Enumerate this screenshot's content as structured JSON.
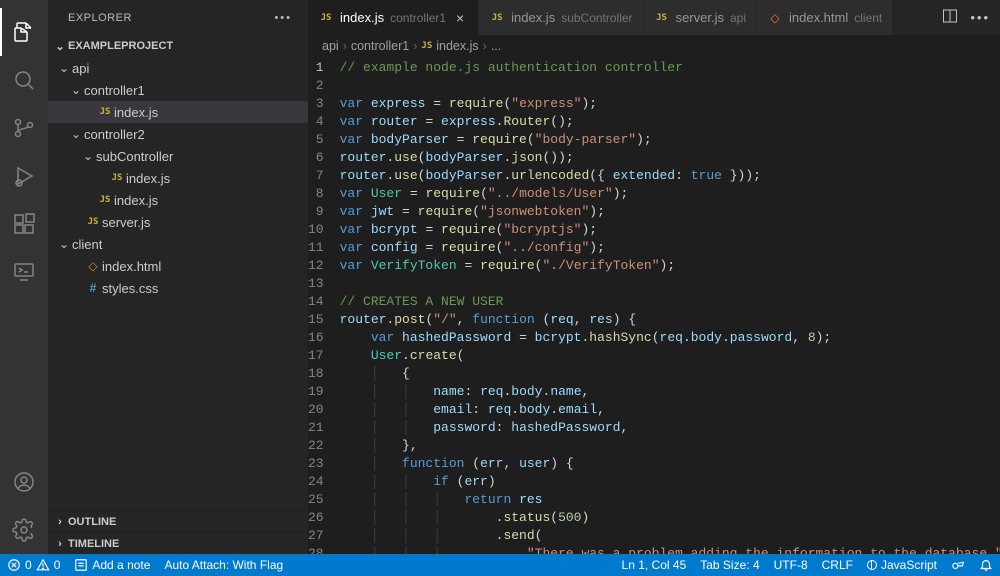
{
  "sidebar": {
    "title": "EXPLORER",
    "project": "EXAMPLEPROJECT",
    "tree": [
      {
        "kind": "folder",
        "open": true,
        "depth": 0,
        "label": "api"
      },
      {
        "kind": "folder",
        "open": true,
        "depth": 1,
        "label": "controller1"
      },
      {
        "kind": "file",
        "icon": "js",
        "depth": 2,
        "label": "index.js",
        "selected": true
      },
      {
        "kind": "folder",
        "open": true,
        "depth": 1,
        "label": "controller2"
      },
      {
        "kind": "folder",
        "open": true,
        "depth": 2,
        "label": "subController"
      },
      {
        "kind": "file",
        "icon": "js",
        "depth": 3,
        "label": "index.js"
      },
      {
        "kind": "file",
        "icon": "js",
        "depth": 2,
        "label": "index.js"
      },
      {
        "kind": "file",
        "icon": "js",
        "depth": 1,
        "label": "server.js"
      },
      {
        "kind": "folder",
        "open": true,
        "depth": 0,
        "label": "client"
      },
      {
        "kind": "file",
        "icon": "html",
        "depth": 1,
        "label": "index.html"
      },
      {
        "kind": "file",
        "icon": "css",
        "depth": 1,
        "label": "styles.css"
      }
    ],
    "sections": {
      "outline": "OUTLINE",
      "timeline": "TIMELINE"
    }
  },
  "tabs": [
    {
      "icon": "js",
      "label": "index.js",
      "desc": "controller1",
      "active": true,
      "close": true
    },
    {
      "icon": "js",
      "label": "index.js",
      "desc": "subController",
      "active": false,
      "close": false
    },
    {
      "icon": "js",
      "label": "server.js",
      "desc": "api",
      "active": false,
      "close": false
    },
    {
      "icon": "html",
      "label": "index.html",
      "desc": "client",
      "active": false,
      "close": false
    }
  ],
  "breadcrumbs": {
    "parts": [
      "api",
      "controller1"
    ],
    "file_icon": "js",
    "file": "index.js",
    "trail": "..."
  },
  "code": {
    "first_line": 1,
    "lines": [
      [
        [
          "comment",
          "// example node.js authentication controller"
        ]
      ],
      [],
      [
        [
          "keyword",
          "var"
        ],
        [
          "punc",
          " "
        ],
        [
          "var",
          "express"
        ],
        [
          "punc",
          " = "
        ],
        [
          "func",
          "require"
        ],
        [
          "punc",
          "("
        ],
        [
          "string",
          "\"express\""
        ],
        [
          "punc",
          ");"
        ]
      ],
      [
        [
          "keyword",
          "var"
        ],
        [
          "punc",
          " "
        ],
        [
          "var",
          "router"
        ],
        [
          "punc",
          " = "
        ],
        [
          "var",
          "express"
        ],
        [
          "punc",
          "."
        ],
        [
          "func",
          "Router"
        ],
        [
          "punc",
          "();"
        ]
      ],
      [
        [
          "keyword",
          "var"
        ],
        [
          "punc",
          " "
        ],
        [
          "var",
          "bodyParser"
        ],
        [
          "punc",
          " = "
        ],
        [
          "func",
          "require"
        ],
        [
          "punc",
          "("
        ],
        [
          "string",
          "\"body-parser\""
        ],
        [
          "punc",
          ");"
        ]
      ],
      [
        [
          "var",
          "router"
        ],
        [
          "punc",
          "."
        ],
        [
          "func",
          "use"
        ],
        [
          "punc",
          "("
        ],
        [
          "var",
          "bodyParser"
        ],
        [
          "punc",
          "."
        ],
        [
          "func",
          "json"
        ],
        [
          "punc",
          "());"
        ]
      ],
      [
        [
          "var",
          "router"
        ],
        [
          "punc",
          "."
        ],
        [
          "func",
          "use"
        ],
        [
          "punc",
          "("
        ],
        [
          "var",
          "bodyParser"
        ],
        [
          "punc",
          "."
        ],
        [
          "func",
          "urlencoded"
        ],
        [
          "punc",
          "({ "
        ],
        [
          "var",
          "extended"
        ],
        [
          "punc",
          ": "
        ],
        [
          "const",
          "true"
        ],
        [
          "punc",
          " }));"
        ]
      ],
      [
        [
          "keyword",
          "var"
        ],
        [
          "punc",
          " "
        ],
        [
          "type",
          "User"
        ],
        [
          "punc",
          " = "
        ],
        [
          "func",
          "require"
        ],
        [
          "punc",
          "("
        ],
        [
          "string",
          "\"../models/User\""
        ],
        [
          "punc",
          ");"
        ]
      ],
      [
        [
          "keyword",
          "var"
        ],
        [
          "punc",
          " "
        ],
        [
          "var",
          "jwt"
        ],
        [
          "punc",
          " = "
        ],
        [
          "func",
          "require"
        ],
        [
          "punc",
          "("
        ],
        [
          "string",
          "\"jsonwebtoken\""
        ],
        [
          "punc",
          ");"
        ]
      ],
      [
        [
          "keyword",
          "var"
        ],
        [
          "punc",
          " "
        ],
        [
          "var",
          "bcrypt"
        ],
        [
          "punc",
          " = "
        ],
        [
          "func",
          "require"
        ],
        [
          "punc",
          "("
        ],
        [
          "string",
          "\"bcryptjs\""
        ],
        [
          "punc",
          ");"
        ]
      ],
      [
        [
          "keyword",
          "var"
        ],
        [
          "punc",
          " "
        ],
        [
          "var",
          "config"
        ],
        [
          "punc",
          " = "
        ],
        [
          "func",
          "require"
        ],
        [
          "punc",
          "("
        ],
        [
          "string",
          "\"../config\""
        ],
        [
          "punc",
          ");"
        ]
      ],
      [
        [
          "keyword",
          "var"
        ],
        [
          "punc",
          " "
        ],
        [
          "type",
          "VerifyToken"
        ],
        [
          "punc",
          " = "
        ],
        [
          "func",
          "require"
        ],
        [
          "punc",
          "("
        ],
        [
          "string",
          "\"./VerifyToken\""
        ],
        [
          "punc",
          ");"
        ]
      ],
      [],
      [
        [
          "comment",
          "// CREATES A NEW USER"
        ]
      ],
      [
        [
          "var",
          "router"
        ],
        [
          "punc",
          "."
        ],
        [
          "func",
          "post"
        ],
        [
          "punc",
          "("
        ],
        [
          "string",
          "\"/\""
        ],
        [
          "punc",
          ", "
        ],
        [
          "keyword",
          "function"
        ],
        [
          "punc",
          " ("
        ],
        [
          "var",
          "req"
        ],
        [
          "punc",
          ", "
        ],
        [
          "var",
          "res"
        ],
        [
          "punc",
          ") {"
        ]
      ],
      [
        [
          "punc",
          "    "
        ],
        [
          "keyword",
          "var"
        ],
        [
          "punc",
          " "
        ],
        [
          "var",
          "hashedPassword"
        ],
        [
          "punc",
          " = "
        ],
        [
          "var",
          "bcrypt"
        ],
        [
          "punc",
          "."
        ],
        [
          "func",
          "hashSync"
        ],
        [
          "punc",
          "("
        ],
        [
          "var",
          "req"
        ],
        [
          "punc",
          "."
        ],
        [
          "var",
          "body"
        ],
        [
          "punc",
          "."
        ],
        [
          "var",
          "password"
        ],
        [
          "punc",
          ", "
        ],
        [
          "num",
          "8"
        ],
        [
          "punc",
          ");"
        ]
      ],
      [
        [
          "punc",
          "    "
        ],
        [
          "type",
          "User"
        ],
        [
          "punc",
          "."
        ],
        [
          "func",
          "create"
        ],
        [
          "punc",
          "("
        ]
      ],
      [
        [
          "guide",
          "    │   "
        ],
        [
          "punc",
          "{"
        ]
      ],
      [
        [
          "guide",
          "    │   │   "
        ],
        [
          "var",
          "name"
        ],
        [
          "punc",
          ": "
        ],
        [
          "var",
          "req"
        ],
        [
          "punc",
          "."
        ],
        [
          "var",
          "body"
        ],
        [
          "punc",
          "."
        ],
        [
          "var",
          "name"
        ],
        [
          "punc",
          ","
        ]
      ],
      [
        [
          "guide",
          "    │   │   "
        ],
        [
          "var",
          "email"
        ],
        [
          "punc",
          ": "
        ],
        [
          "var",
          "req"
        ],
        [
          "punc",
          "."
        ],
        [
          "var",
          "body"
        ],
        [
          "punc",
          "."
        ],
        [
          "var",
          "email"
        ],
        [
          "punc",
          ","
        ]
      ],
      [
        [
          "guide",
          "    │   │   "
        ],
        [
          "var",
          "password"
        ],
        [
          "punc",
          ": "
        ],
        [
          "var",
          "hashedPassword"
        ],
        [
          "punc",
          ","
        ]
      ],
      [
        [
          "guide",
          "    │   "
        ],
        [
          "punc",
          "},"
        ]
      ],
      [
        [
          "guide",
          "    │   "
        ],
        [
          "keyword",
          "function"
        ],
        [
          "punc",
          " ("
        ],
        [
          "var",
          "err"
        ],
        [
          "punc",
          ", "
        ],
        [
          "var",
          "user"
        ],
        [
          "punc",
          ") {"
        ]
      ],
      [
        [
          "guide",
          "    │   │   "
        ],
        [
          "keyword",
          "if"
        ],
        [
          "punc",
          " ("
        ],
        [
          "var",
          "err"
        ],
        [
          "punc",
          ")"
        ]
      ],
      [
        [
          "guide",
          "    │   │   │   "
        ],
        [
          "keyword",
          "return"
        ],
        [
          "punc",
          " "
        ],
        [
          "var",
          "res"
        ]
      ],
      [
        [
          "guide",
          "    │   │   │       "
        ],
        [
          "punc",
          "."
        ],
        [
          "func",
          "status"
        ],
        [
          "punc",
          "("
        ],
        [
          "num",
          "500"
        ],
        [
          "punc",
          ")"
        ]
      ],
      [
        [
          "guide",
          "    │   │   │       "
        ],
        [
          "punc",
          "."
        ],
        [
          "func",
          "send"
        ],
        [
          "punc",
          "("
        ]
      ],
      [
        [
          "guide",
          "    │   │   │           "
        ],
        [
          "string",
          "\"There was a problem adding the information to the database.\""
        ]
      ]
    ]
  },
  "status": {
    "errors": "0",
    "warnings": "0",
    "note": "Add a note",
    "auto_attach": "Auto Attach: With Flag",
    "cursor": "Ln 1, Col 45",
    "tab_size": "Tab Size: 4",
    "encoding": "UTF-8",
    "eol": "CRLF",
    "language": "JavaScript"
  }
}
